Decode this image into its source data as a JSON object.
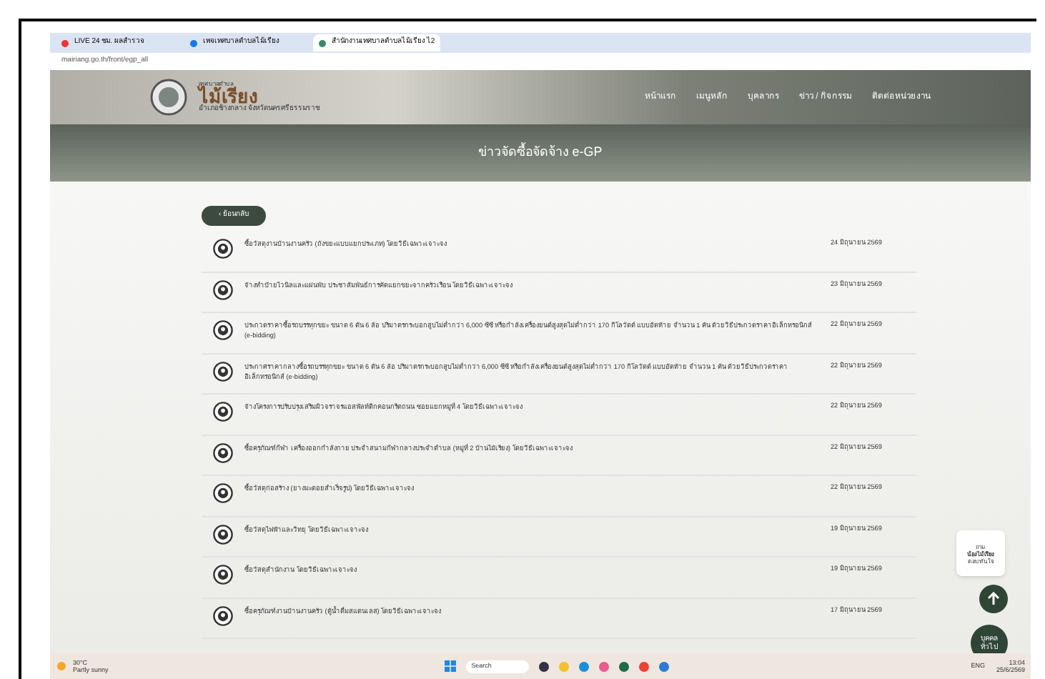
{
  "browser": {
    "tabs": [
      {
        "label": "LIVE 24 ชม. ผลสำรวจ",
        "selected": false
      },
      {
        "label": "เพจเทศบาลตำบลไม้เรียง",
        "selected": false
      },
      {
        "label": "สำนักงานเทศบาลตำบลไม้เรียง ไ2",
        "selected": true
      }
    ],
    "url": "mairiang.go.th/front/egp_all"
  },
  "site": {
    "logo_small": "เทศบาลตำบล",
    "logo": "ไม้เรียง",
    "logo_sub": "อำเภอช้างกลาง จังหวัดนครศรีธรรมราช",
    "nav": [
      "หน้าแรก",
      "เมนูหลัก",
      "บุคลากร",
      "ข่าว / กิจกรรม",
      "ติดต่อหน่วยงาน"
    ],
    "page_title": "ข่าวจัดซื้อจัดจ้าง e-GP",
    "back": "‹ ย้อนกลับ",
    "items": [
      {
        "title": "ซื้อวัสดุงานบ้านงานครัว (ถังขยะแบบแยกประเภท) โดยวิธีเฉพาะเจาะจง",
        "date": "24 มิถุนายน 2569"
      },
      {
        "title": "จ้างทำป้ายไวนิลและแผ่นพับ ประชาสัมพันธ์การคัดแยกขยะจากครัวเรือน โดยวิธีเฉพาะเจาะจง",
        "date": "23 มิถุนายน 2569"
      },
      {
        "title": "ประกวดราคาซื้อรถบรรทุกขยะ ขนาด 6 ตัน 6 ล้อ ปริมาตรกระบอกสูบไม่ต่ำกว่า 6,000 ซีซี หรือกำลังเครื่องยนต์สูงสุดไม่ต่ำกว่า 170 กิโลวัตต์ แบบอัดท้าย จำนวน 1 คัน ด้วยวิธีประกวดราคาอิเล็กทรอนิกส์ (e-bidding)",
        "date": "22 มิถุนายน 2569"
      },
      {
        "title": "ประกาศราคากลางซื้อรถบรรทุกขยะ ขนาด 6 ตัน 6 ล้อ ปริมาตรกระบอกสูบไม่ต่ำกว่า 6,000 ซีซี หรือกำลังเครื่องยนต์สูงสุดไม่ต่ำกว่า 170 กิโลวัตต์ แบบอัดท้าย จำนวน 1 คัน ด้วยวิธีประกวดราคาอิเล็กทรอนิกส์ (e-bidding)",
        "date": "22 มิถุนายน 2569"
      },
      {
        "title": "จ้างโครงการปรับปรุงเสริมผิวจราจรแอสฟัลท์ติกคอนกรีตถนน ซอยแยกหมู่ที่ 4 โดยวิธีเฉพาะเจาะจง",
        "date": "22 มิถุนายน 2569"
      },
      {
        "title": "ซื้อครุภัณฑ์กีฬา เครื่องออกกำลังกาย ประจำสนามกีฬากลางประจำตำบล (หมู่ที่ 2 บ้านไม้เรียง) โดยวิธีเฉพาะเจาะจง",
        "date": "22 มิถุนายน 2569"
      },
      {
        "title": "ซื้อวัสดุก่อสร้าง (ยางมะตอยสำเร็จรูป) โดยวิธีเฉพาะเจาะจง",
        "date": "22 มิถุนายน 2569"
      },
      {
        "title": "ซื้อวัสดุไฟฟ้าและวิทยุ โดยวิธีเฉพาะเจาะจง",
        "date": "19 มิถุนายน 2569"
      },
      {
        "title": "ซื้อวัสดุสำนักงาน โดยวิธีเฉพาะเจาะจง",
        "date": "19 มิถุนายน 2569"
      },
      {
        "title": "ซื้อครุภัณฑ์งานบ้านงานครัว (ตู้น้ำดื่มสแตนเลส) โดยวิธีเฉพาะเจาะจง",
        "date": "17 มิถุนายน 2569"
      }
    ],
    "chat_bubble": [
      "ถาม",
      "น้องไม้เรียง",
      "ตอบทันใจ"
    ],
    "badge": "บุคคลทั่วไป"
  },
  "taskbar": {
    "temp": "30°C",
    "weather": "Partly sunny",
    "search": "Search",
    "lang": "ENG",
    "time": "13:04",
    "date": "25/6/2569"
  }
}
